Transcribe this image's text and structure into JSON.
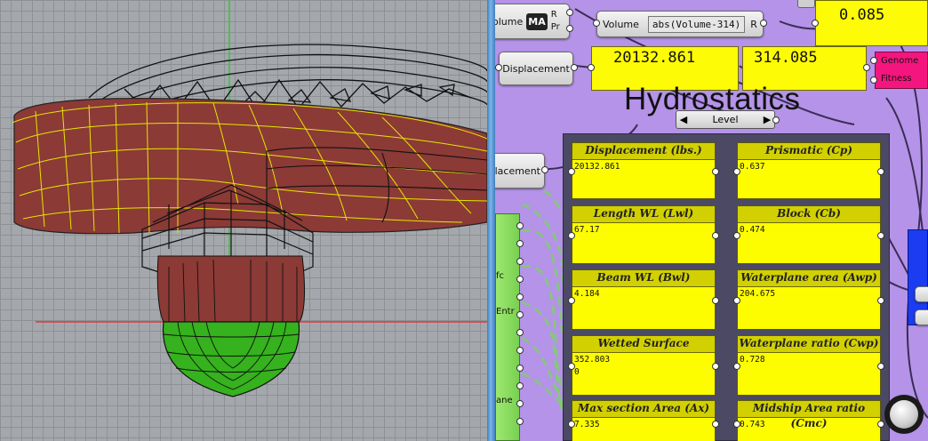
{
  "viewport": {
    "colors": {
      "grid": "#8d9196",
      "hull_fill": "#8b3a36",
      "waterline": "#e5e500",
      "below_water": "#35b21d",
      "axis_x": "#e02222",
      "axis_y": "#22c822"
    }
  },
  "canvas": {
    "title": "Hydrostatics",
    "top_components": {
      "volume_left": {
        "label_partial": "olume",
        "badge": "MA",
        "out_r": "R",
        "out_pr": "Pr"
      },
      "volume_expr": {
        "label": "Volume",
        "expression": "abs(Volume-314)",
        "out": "R"
      },
      "displacement_button": "Displacement",
      "displacement_left_partial": "placement"
    },
    "top_panels": {
      "top_right_value": "0.085",
      "displacement_value": "20132.861",
      "volume_value": "314.085"
    },
    "genome": {
      "line1": "Genome",
      "line2": "Fitness"
    },
    "slider": {
      "left_arrow": "◀",
      "label": "Level",
      "right_arrow": "▶"
    },
    "green_params": [
      "fc",
      "Entr",
      "ane"
    ],
    "stats": [
      {
        "label": "Displacement (lbs.)",
        "value": "20132.861",
        "extra": ""
      },
      {
        "label": "Prismatic (Cp)",
        "value": "0.637",
        "extra": ""
      },
      {
        "label": "Length WL (Lwl)",
        "value": "67.17",
        "extra": ""
      },
      {
        "label": "Block (Cb)",
        "value": "0.474",
        "extra": ""
      },
      {
        "label": "Beam WL (Bwl)",
        "value": "4.184",
        "extra": ""
      },
      {
        "label": "Waterplane area (Awp)",
        "value": "204.675",
        "extra": ""
      },
      {
        "label": "Wetted Surface",
        "value": "352.803",
        "extra": "0"
      },
      {
        "label": "Waterplane ratio (Cwp)",
        "value": "0.728",
        "extra": ""
      },
      {
        "label": "Max section Area (Ax)",
        "value": "7.335",
        "extra": ""
      },
      {
        "label": "Midship Area ratio (Cmc)",
        "value": "0.743",
        "extra": ""
      }
    ],
    "colors": {
      "canvas_bg": "#b493e8",
      "panel_yellow": "#fdfb05",
      "group_bg": "#4b4964",
      "genome": "#f5157e",
      "blue_box": "#1b3cf0"
    }
  }
}
